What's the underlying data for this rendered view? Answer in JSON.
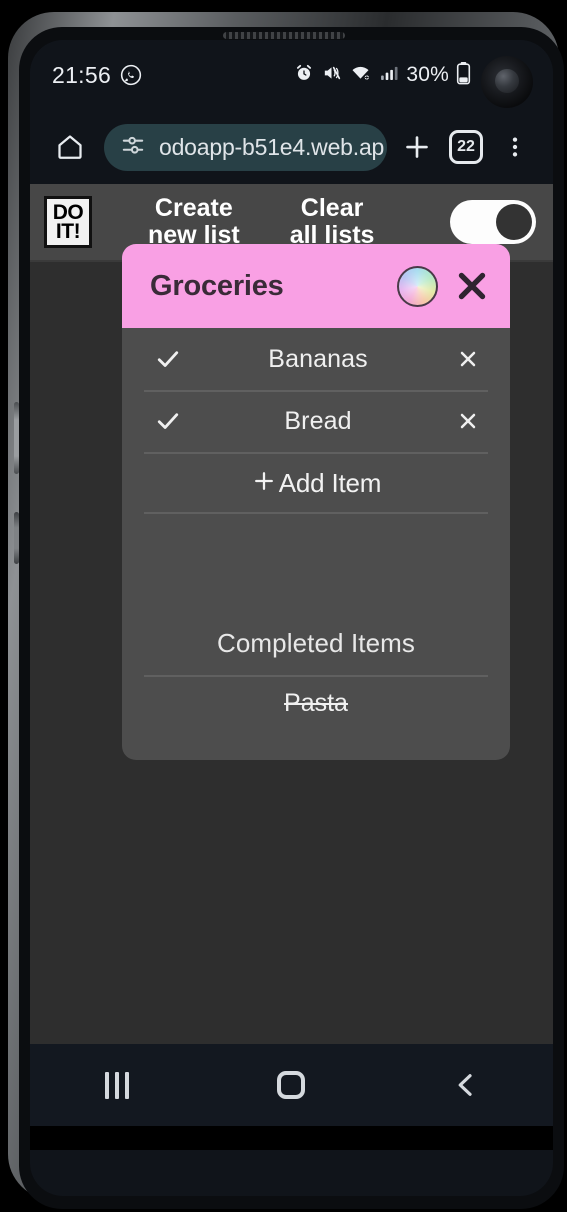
{
  "status_bar": {
    "clock": "21:56",
    "whatsapp_icon": "whatsapp-icon",
    "alarm_icon": "alarm-icon",
    "mute_icon": "volume-mute-icon",
    "wifi_icon": "wifi-icon",
    "signal_icon": "cellular-signal-icon",
    "battery_percent": "30%",
    "battery_icon": "battery-icon"
  },
  "browser": {
    "home_icon": "home-icon",
    "page_info_icon": "page-info-icon",
    "url": "odoapp-b51e4.web.ap",
    "new_tab_icon": "plus-icon",
    "tab_count": "22",
    "menu_icon": "overflow-menu-icon"
  },
  "app": {
    "logo": {
      "line1": "DO",
      "line2": "IT!"
    },
    "create_new_list": "Create\nnew list",
    "create_new_list_line1": "Create",
    "create_new_list_line2": "new list",
    "clear_all_lists_line1": "Clear",
    "clear_all_lists_line2": "all lists",
    "theme_toggle_state": "on",
    "colors": {
      "header_bg": "#474747",
      "page_bg": "#2e2e2e",
      "card_bg": "#4d4d4d",
      "card_header_pink": "#f9a0e4"
    }
  },
  "list_card": {
    "title": "Groceries",
    "color_wheel_icon": "color-picker-icon",
    "close_icon": "close-icon",
    "items": [
      {
        "label": "Bananas",
        "check_icon": "check-icon",
        "delete_icon": "close-icon"
      },
      {
        "label": "Bread",
        "check_icon": "check-icon",
        "delete_icon": "close-icon"
      }
    ],
    "add_item": {
      "plus_icon": "plus-icon",
      "label": "Add Item"
    },
    "completed_heading": "Completed Items",
    "completed_items": [
      {
        "label": "Pasta"
      }
    ]
  },
  "nav_bar": {
    "recents_icon": "recents-icon",
    "home_icon": "home-icon",
    "back_icon": "back-icon"
  }
}
